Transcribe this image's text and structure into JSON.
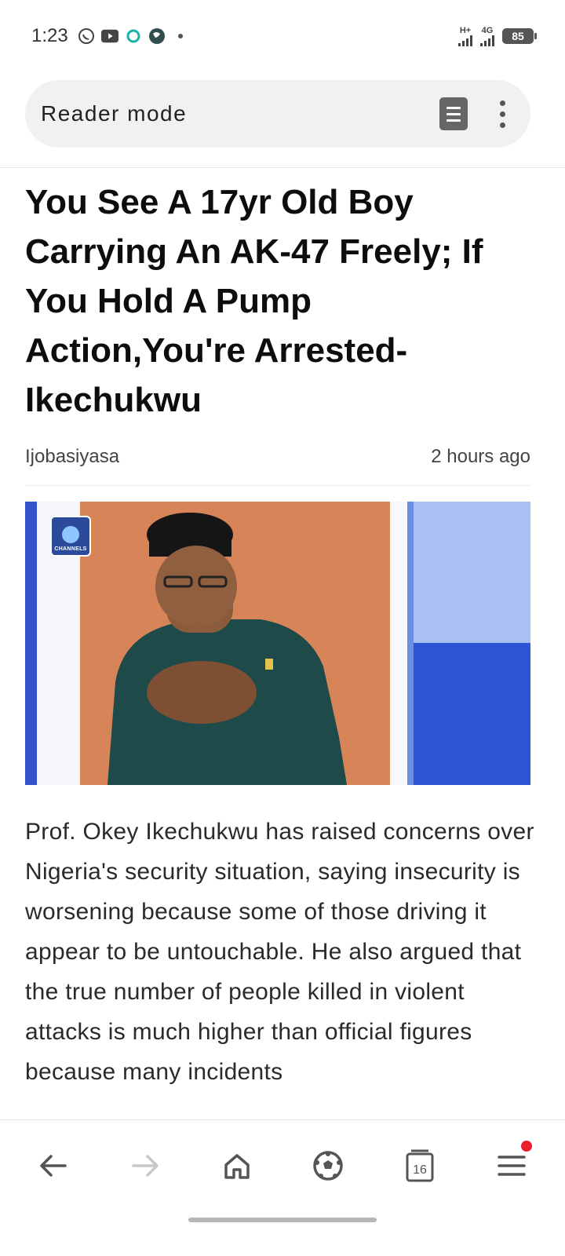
{
  "status_bar": {
    "time": "1:23",
    "icons": [
      "whatsapp-icon",
      "youtube-icon",
      "sync-icon",
      "globe-icon",
      "dot-icon"
    ],
    "network1": "H+",
    "network2": "4G",
    "battery": "85"
  },
  "reader": {
    "title": "Reader mode"
  },
  "article": {
    "headline": "You See A 17yr Old Boy Carrying An AK-47 Freely; If You Hold A Pump Action,You're Arrested- Ikechukwu",
    "source": "Ijobasiyasa",
    "time_ago": "2 hours ago",
    "image_logo_text": "CHANNELS",
    "body": "Prof. Okey Ikechukwu has raised concerns over Nigeria's security situation, saying insecurity is worsening because some of those driving it appear to be untouchable. He also argued that the true number of people killed in violent attacks is much higher than official figures because many incidents"
  },
  "bottom_nav": {
    "tab_count": "16",
    "colors": {
      "notification": "#e8202c",
      "forward_disabled": "#c8c8c8"
    }
  }
}
